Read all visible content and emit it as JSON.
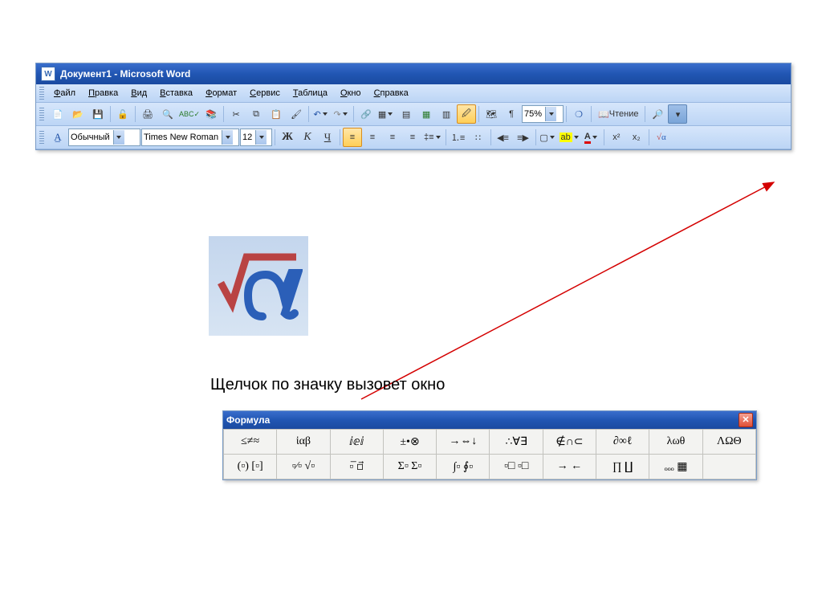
{
  "word": {
    "title": "Документ1 - Microsoft Word",
    "menu": [
      "Файл",
      "Правка",
      "Вид",
      "Вставка",
      "Формат",
      "Сервис",
      "Таблица",
      "Окно",
      "Справка"
    ],
    "zoom": "75%",
    "reading_label": "Чтение",
    "style": "Обычный",
    "font": "Times New Roman",
    "size": "12",
    "bold": "Ж",
    "italic": "К",
    "underline": "Ч",
    "superscript": "x²",
    "subscript": "x₂",
    "equation_icon": "√α",
    "font_color": "A",
    "highlight": "ab"
  },
  "caption": "Щелчок по значку вызовет окно",
  "formula": {
    "title": "Формула",
    "row1": [
      "≤≠≈",
      "ἱαβ",
      "ⅈⅇⅈ",
      "±•⊗",
      "→⇔↓",
      "∴∀∃",
      "∉∩⊂",
      "∂∞ℓ",
      "λωθ",
      "ΛΩΘ"
    ],
    "row2": [
      "(▫) [▫]",
      "▫⁄▫ √▫",
      "▫̅ ▫⃗",
      "Σ▫ Σ▫",
      "∫▫ ∮▫",
      "▫□ ▫□",
      "→ ←",
      "∏ ∐",
      "ₒₒₒ ▦",
      ""
    ]
  }
}
